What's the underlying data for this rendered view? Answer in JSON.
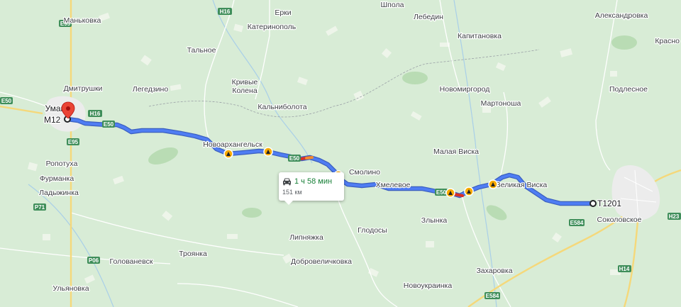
{
  "map": {
    "route": {
      "duration": "1 ч 58 мин",
      "distance": "151 км",
      "start_label": "М12",
      "end_label": "Т1201"
    },
    "places": {
      "mankovka": "Маньковка",
      "erki": "Ерки",
      "katerinopol": "Катеринополь",
      "shpola": "Шпола",
      "lebedin": "Лебедин",
      "aleksandrovka": "Александровка",
      "krasno": "Красно",
      "talnoe": "Тальное",
      "kapitanovka": "Капитановка",
      "dmitrushki": "Дмитрушки",
      "legedzino": "Легедзино",
      "krivye_kolena": "Кривые\nКолена",
      "kalnibolota": "Кальниболота",
      "novomirgorod": "Новомиргород",
      "martonosha": "Мартоноша",
      "podlesnoe": "Подлесное",
      "uman": "Умань",
      "novoarhangelsk": "Новоархангельск",
      "malaya_viska": "Малая Виска",
      "smolino": "Смолино",
      "hmelevoe": "Хмелевое",
      "velikaya_viska": "Великая Виска",
      "ropotuha": "Ропотуха",
      "furmanka": "Фурманка",
      "ladyzhinka": "Ладыжинка",
      "zlynka": "Злынка",
      "sokolovskoe": "Соколовское",
      "lipnyazhka": "Липняжка",
      "glodosy": "Глодосы",
      "troyanka": "Троянка",
      "dobrovelichkovka": "Добровеличковка",
      "golovanevsk": "Голованевск",
      "zaharovka": "Захаровка",
      "novoukrainka": "Новоукраинка",
      "ulyanovka": "Ульяновка"
    },
    "roads": {
      "e95_top": "E95",
      "h16_top": "H16",
      "e50_left": "E50",
      "h16_mid": "H16",
      "e50_route": "E50",
      "e95_mid": "E95",
      "e50_mid": "E50",
      "e50_east": "E50",
      "p71": "P71",
      "e584_east": "E584",
      "h23": "H23",
      "p06": "P06",
      "h14": "H14",
      "e584_south": "E584"
    },
    "colors": {
      "land": "#d8ecd6",
      "forest": "#b9dcb4",
      "route": "#4f7df3",
      "route_outline": "#3b5fbf",
      "highway": "#f5d87a",
      "road_shield": "#3f8e5a",
      "incident": "#f9ab00",
      "slow_traffic": "#f28b30",
      "jam": "#d93025",
      "pin": "#ea4335",
      "travel_time": "#188038"
    },
    "icons": {
      "car": "car-icon",
      "pin": "map-pin-icon",
      "incident": "road-work-icon"
    }
  }
}
